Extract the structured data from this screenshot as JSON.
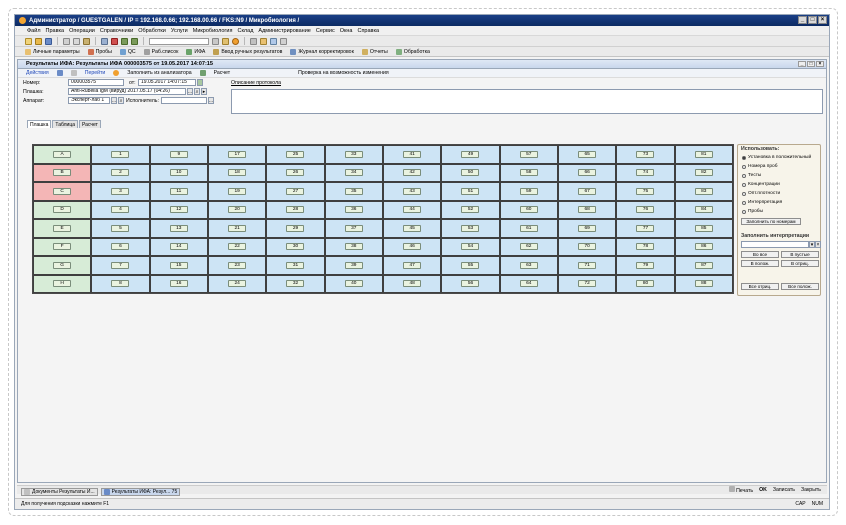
{
  "window": {
    "title": "Администратор / GUESTGALEN / IP = 192.168.0.66; 192.168.00.66 / FKS:N9 / Микробиология /",
    "btn_min": "_",
    "btn_max": "□",
    "btn_close": "×"
  },
  "menu": [
    "Файл",
    "Правка",
    "Операции",
    "Справочники",
    "Обработки",
    "Услуги",
    "Микробиология",
    "Склад",
    "Администрирование",
    "Сервис",
    "Окна",
    "Справка"
  ],
  "toolbar2": [
    "Личные параметры",
    "Пробы",
    "QC",
    "Раб.список",
    "ИФА",
    "Ввод ручных результатов",
    "Журнал корректировок",
    "Отчеты",
    "Обработка"
  ],
  "doc": {
    "title": "Результаты ИФА: Результаты ИФА 000003575 от 19.05.2017 14:07:15",
    "actions": {
      "actions": "Действия",
      "go": "Перейти",
      "fill": "Заполнить из анализатора",
      "calc": "Расчет",
      "check": "Проверка на возможность изменения"
    },
    "form": {
      "number_label": "Номер:",
      "number": "000003575",
      "from_label": "от:",
      "date": "19.05.2017 14:07:15",
      "plate_label": "Плашка:",
      "plate": "Anti-Rubella IgM (вируд) 2017.05.17 (04:26)",
      "device_label": "Аппарат:",
      "device": "Эксперт-лаб 1",
      "executor_label": "Исполнитель:",
      "protocol_link": "Описание протокола"
    },
    "tabs": [
      "Плашка",
      "Таблица",
      "Расчет"
    ]
  },
  "grid": {
    "rows": [
      [
        "A",
        "1",
        "9",
        "17",
        "25",
        "33",
        "41",
        "49",
        "57",
        "65",
        "73",
        "81"
      ],
      [
        "B",
        "2",
        "10",
        "18",
        "26",
        "34",
        "42",
        "50",
        "58",
        "66",
        "74",
        "82"
      ],
      [
        "C",
        "3",
        "11",
        "19",
        "27",
        "35",
        "43",
        "51",
        "59",
        "67",
        "75",
        "83"
      ],
      [
        "D",
        "4",
        "12",
        "20",
        "28",
        "36",
        "44",
        "52",
        "60",
        "68",
        "76",
        "84"
      ],
      [
        "E",
        "5",
        "13",
        "21",
        "29",
        "37",
        "45",
        "53",
        "61",
        "69",
        "77",
        "85"
      ],
      [
        "F",
        "6",
        "14",
        "22",
        "30",
        "38",
        "46",
        "54",
        "62",
        "70",
        "78",
        "86"
      ],
      [
        "G",
        "7",
        "15",
        "23",
        "31",
        "39",
        "47",
        "55",
        "63",
        "71",
        "79",
        "87"
      ],
      [
        "H",
        "8",
        "16",
        "24",
        "32",
        "40",
        "48",
        "56",
        "64",
        "72",
        "80",
        "88"
      ]
    ],
    "highlight_rows": [
      1,
      2
    ],
    "colors": {
      "cell": "#cde4f5",
      "head": "#d7ecd7",
      "pink": "#f4b6b6"
    }
  },
  "panel": {
    "use_title": "Использовать:",
    "options": [
      "Установка в положительный",
      "Номера проб",
      "Тесты",
      "Концентрации",
      "Опт.плотности",
      "Интерпретация",
      "Пробы"
    ],
    "selected": 0,
    "fill_by_number": "Заполнить по номерам",
    "interp_title": "Заполнить интерпретации",
    "all_btn": "Во все",
    "empty_btn": "В пустые",
    "pos_btn": "В полож.",
    "neg_btn": "В отриц.",
    "all_neg": "Все отриц.",
    "all_pos": "Все полож."
  },
  "bottom": {
    "print": "Печать",
    "ok": "OK",
    "save": "Записать",
    "close": "Закрыть"
  },
  "taskbar": [
    "Документы Результаты И...",
    "Результаты ИФА: Резул... 75"
  ],
  "status": {
    "hint": "Для получения подсказки нажмите F1",
    "cap": "CAP",
    "num": "NUM"
  }
}
